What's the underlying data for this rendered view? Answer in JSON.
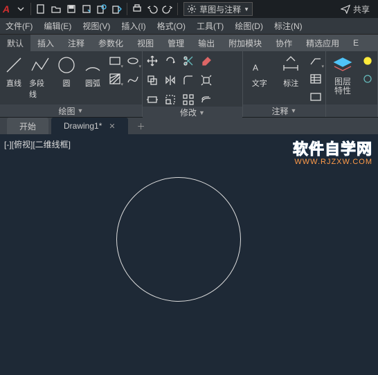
{
  "titlebar": {
    "workspace_label": "草图与注释",
    "share_label": "共享"
  },
  "menubar": {
    "items": [
      {
        "label": "文件(F)"
      },
      {
        "label": "编辑(E)"
      },
      {
        "label": "视图(V)"
      },
      {
        "label": "插入(I)"
      },
      {
        "label": "格式(O)"
      },
      {
        "label": "工具(T)"
      },
      {
        "label": "绘图(D)"
      },
      {
        "label": "标注(N)"
      }
    ]
  },
  "ribbon_tabs": {
    "items": [
      {
        "label": "默认"
      },
      {
        "label": "插入"
      },
      {
        "label": "注释"
      },
      {
        "label": "参数化"
      },
      {
        "label": "视图"
      },
      {
        "label": "管理"
      },
      {
        "label": "输出"
      },
      {
        "label": "附加模块"
      },
      {
        "label": "协作"
      },
      {
        "label": "精选应用"
      },
      {
        "label": "E"
      }
    ]
  },
  "panels": {
    "draw": {
      "title": "绘图",
      "line": "直线",
      "polyline": "多段线",
      "circle": "圆",
      "arc": "圆弧"
    },
    "modify": {
      "title": "修改"
    },
    "annotate": {
      "title": "注释",
      "text": "文字",
      "dim": "标注"
    },
    "layers": {
      "title": "图层",
      "props": "特性"
    }
  },
  "doctabs": {
    "start": "开始",
    "drawing": "Drawing1*"
  },
  "canvas": {
    "view_label": "[-][俯视][二维线框]",
    "watermark_main": "软件自学网",
    "watermark_sub": "WWW.RJZXW.COM"
  }
}
